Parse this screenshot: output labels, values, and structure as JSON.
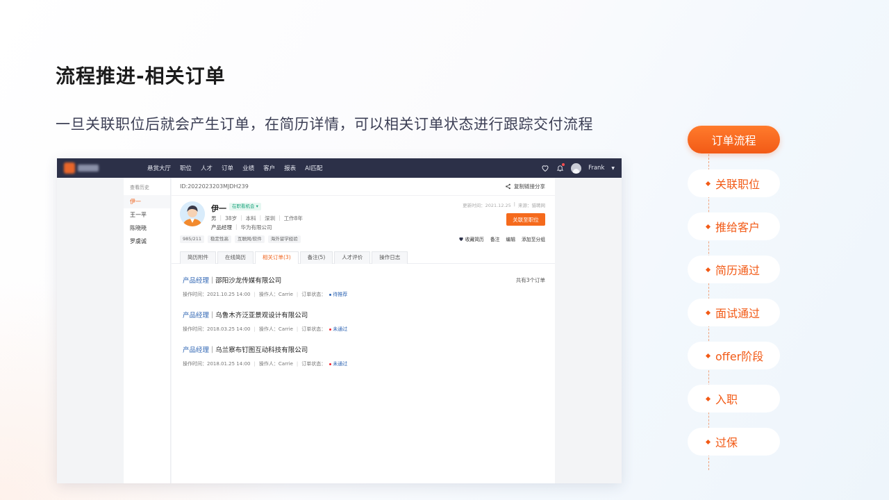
{
  "slide": {
    "title": "流程推进-相关订单",
    "subtitle": "一旦关联职位后就会产生订单，在简历详情，可以相关订单状态进行跟踪交付流程"
  },
  "app": {
    "nav": [
      "悬赏大厅",
      "职位",
      "人才",
      "订单",
      "业绩",
      "客户",
      "报表",
      "AI匹配"
    ],
    "user_name": "Frank",
    "history": {
      "title": "查看历史",
      "items": [
        "伊一",
        "王一平",
        "陈晓晓",
        "罗虞诚"
      ]
    },
    "detail": {
      "id": "ID:2022023203MJDH239",
      "share_label": "复制链接分享",
      "name": "伊一",
      "status_tag": "在职看机会 ▾",
      "meta": [
        "男",
        "38岁",
        "本科",
        "深圳",
        "工作8年"
      ],
      "job_title": "产品经理",
      "company": "华为有限公司",
      "updated": "更新时间：2021.12.25",
      "source": "来源：猎聘网",
      "link_button": "关联至职位",
      "tags": [
        "985/211",
        "稳定性高",
        "互联网/软件",
        "海外留学经验"
      ],
      "actions": [
        "收藏简历",
        "备注",
        "编辑",
        "添加至分组"
      ],
      "tabs": [
        "简历附件",
        "在线简历",
        "相关订单(3)",
        "备注(5)",
        "人才评价",
        "操作日志"
      ],
      "order_count": "共有3个订单",
      "orders": [
        {
          "role": "产品经理",
          "company": "邵阳沙龙传媒有限公司",
          "time": "操作时间：2021.10.25  14:00",
          "operator": "操作人：Carrie",
          "status_label": "订单状态：",
          "status": "待推荐",
          "status_color": "#2d64b3"
        },
        {
          "role": "产品经理",
          "company": "乌鲁木齐泛亚景观设计有限公司",
          "time": "操作时间：2018.03.25  14:00",
          "operator": "操作人：Carrie",
          "status_label": "订单状态：",
          "status": "未通过",
          "status_color": "#f5222d"
        },
        {
          "role": "产品经理",
          "company": "乌兰察布钉图互动科技有限公司",
          "time": "操作时间：2018.01.25  14:00",
          "operator": "操作人：Carrie",
          "status_label": "订单状态：",
          "status": "未通过",
          "status_color": "#f5222d"
        }
      ]
    }
  },
  "flow": {
    "active": "订单流程",
    "steps": [
      "关联职位",
      "推给客户",
      "简历通过",
      "面试通过",
      "offer阶段",
      "入职",
      "过保"
    ],
    "accent": "#f25a16"
  }
}
